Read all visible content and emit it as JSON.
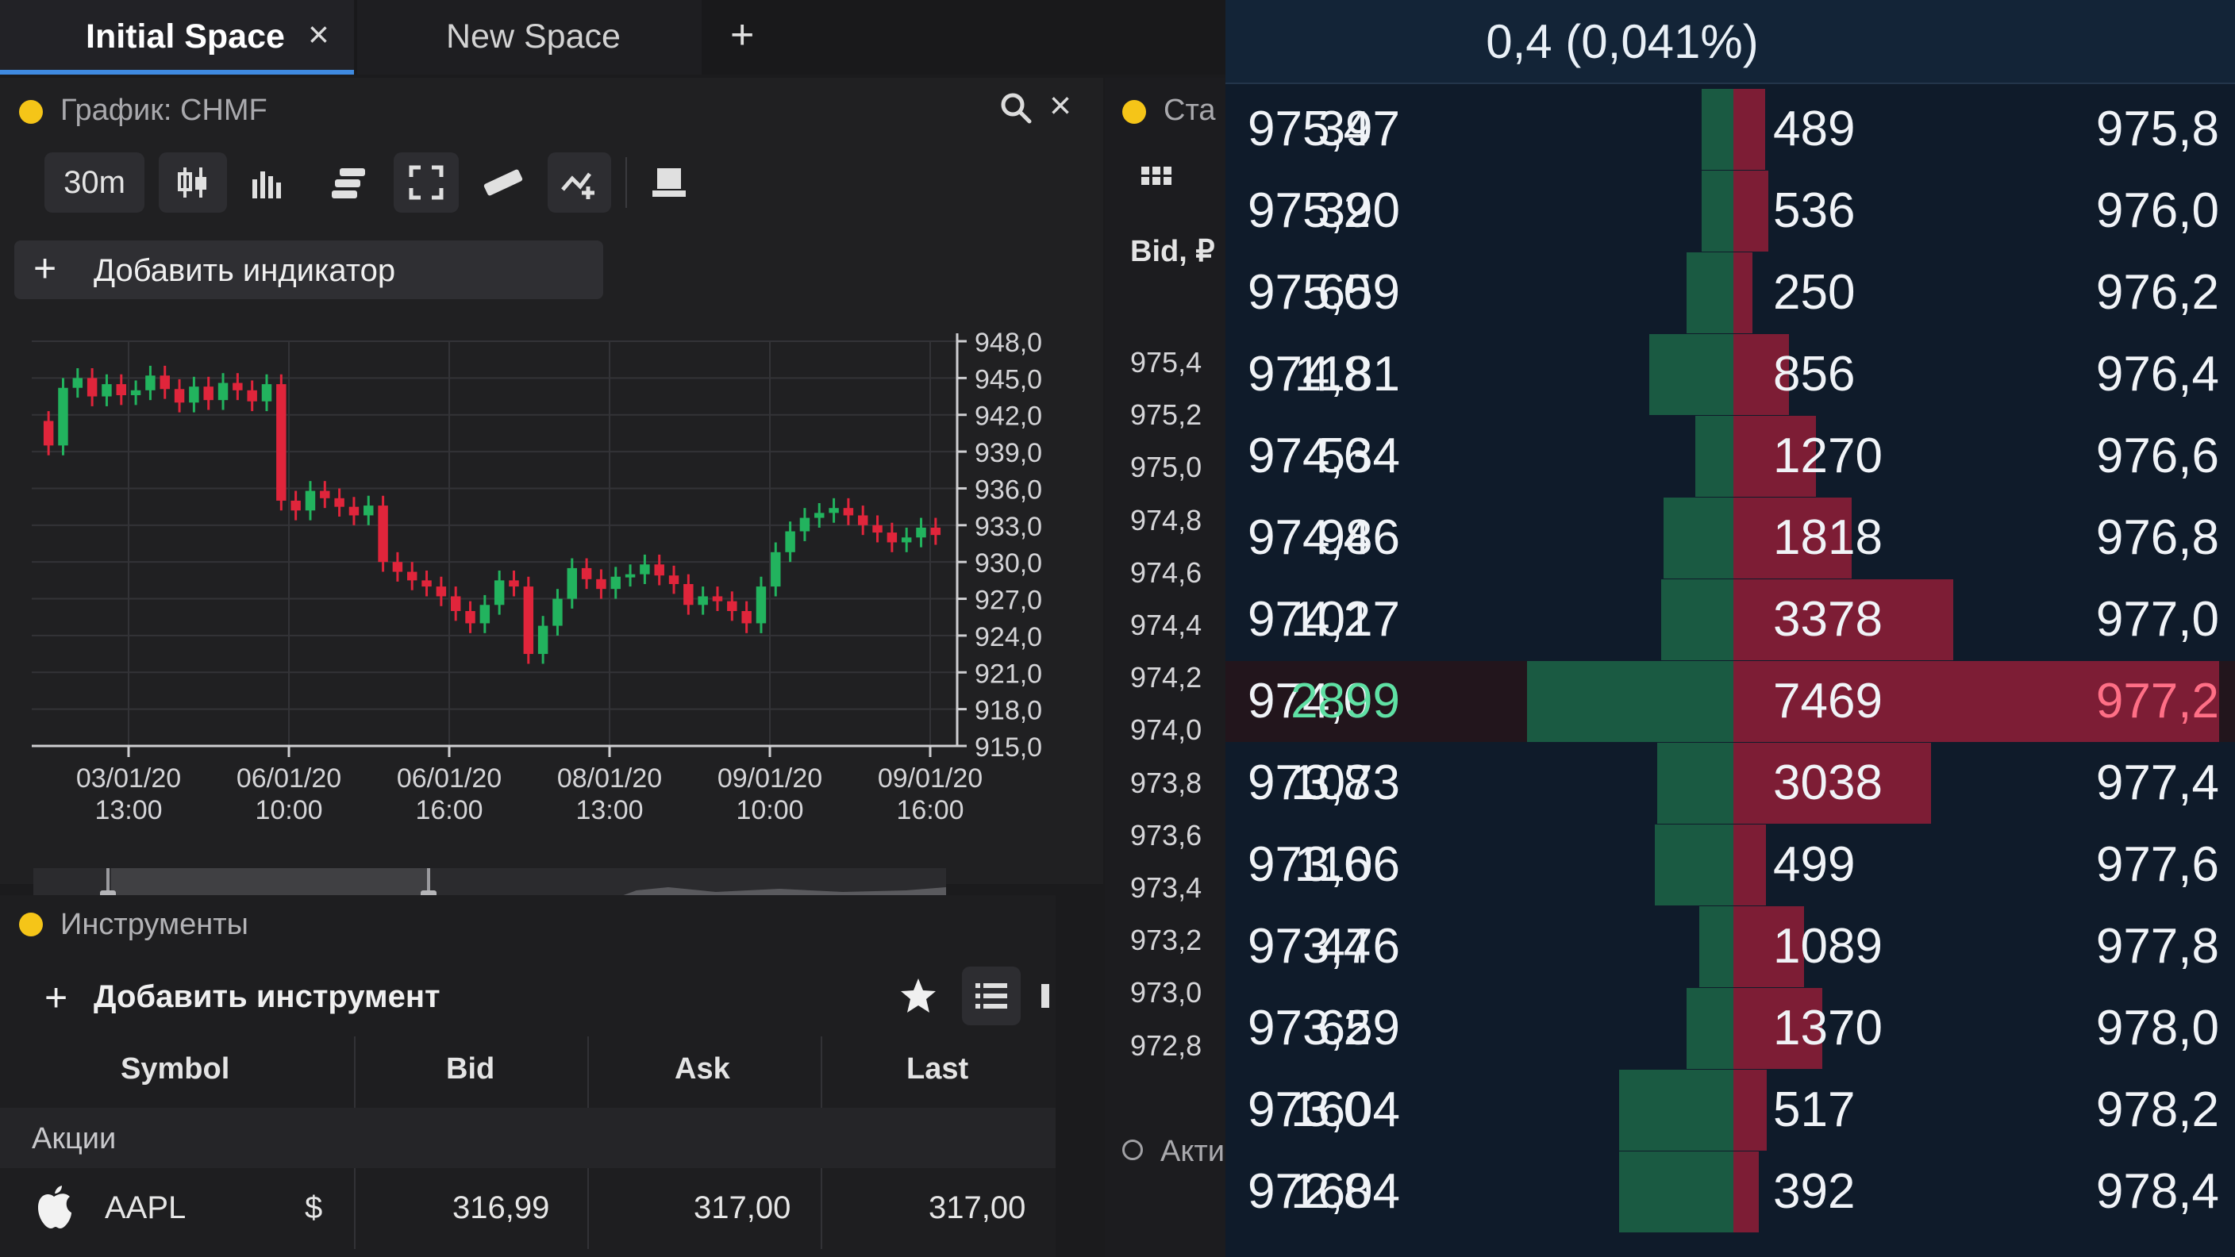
{
  "tabs": [
    {
      "label": "Initial Space",
      "active": true,
      "close": "×"
    },
    {
      "label": "New Space",
      "active": false
    }
  ],
  "tab_add": "+",
  "chart_panel": {
    "title": "График: CHMF",
    "search_icon": "search-icon",
    "close": "×",
    "timeframe": "30m",
    "toolbar_icons": [
      "candles-icon",
      "bars-icon",
      "layers-icon",
      "fullscreen-icon",
      "ruler-icon",
      "compare-icon",
      "save-icon"
    ],
    "add_indicator": "Добавить индикатор",
    "plus": "+"
  },
  "chart_data": {
    "type": "candlestick",
    "title": "",
    "ylim": [
      915.0,
      948.0
    ],
    "y_ticks": [
      "948,0",
      "945,0",
      "942,0",
      "939,0",
      "936,0",
      "933,0",
      "930,0",
      "927,0",
      "924,0",
      "921,0",
      "918,0",
      "915,0"
    ],
    "x_ticks": [
      {
        "date": "03/01/20",
        "time": "13:00"
      },
      {
        "date": "06/01/20",
        "time": "10:00"
      },
      {
        "date": "06/01/20",
        "time": "16:00"
      },
      {
        "date": "08/01/20",
        "time": "13:00"
      },
      {
        "date": "09/01/20",
        "time": "10:00"
      },
      {
        "date": "09/01/20",
        "time": "16:00"
      }
    ],
    "close_series": [
      939.5,
      944.2,
      945.0,
      943.5,
      944.5,
      943.6,
      944.0,
      945.2,
      944.1,
      943.0,
      944.3,
      943.2,
      944.6,
      944.0,
      943.1,
      944.5,
      935.0,
      934.2,
      935.8,
      935.2,
      934.5,
      933.8,
      934.6,
      930.0,
      929.2,
      928.5,
      928.0,
      927.2,
      926.0,
      925.0,
      926.5,
      928.5,
      928.0,
      922.5,
      924.8,
      927.0,
      929.5,
      928.6,
      927.8,
      928.8,
      929.0,
      929.8,
      928.9,
      928.2,
      926.5,
      927.2,
      926.8,
      926.0,
      925.0,
      928.0,
      930.8,
      932.5,
      933.6,
      934.0,
      934.4,
      933.8,
      933.0,
      932.4,
      931.6,
      932.0,
      932.8,
      932.2
    ]
  },
  "instruments": {
    "title": "Инструменты",
    "add_label": "Добавить инструмент",
    "plus": "+",
    "star_icon": "star-icon",
    "list_icon": "list-icon",
    "columns": [
      "Symbol",
      "Bid",
      "Ask",
      "Last"
    ],
    "section": "Акции",
    "rows": [
      {
        "logo": "apple-icon",
        "symbol": "AAPL",
        "currency": "$",
        "bid": "316,99",
        "ask": "317,00",
        "last": "317,00"
      }
    ]
  },
  "middle": {
    "title_fragment": "Ста",
    "header_fragment": "Bid, ₽",
    "footer_fragment": "Акти",
    "prices": [
      "975,4",
      "975,2",
      "975,0",
      "974,8",
      "974,6",
      "974,4",
      "974,2",
      "974,0",
      "973,8",
      "973,6",
      "973,4",
      "973,2",
      "973,0",
      "972,8"
    ]
  },
  "order_book": {
    "change": "0,4 (0,041%)",
    "rows": [
      {
        "bid": "975,4",
        "bid_vol": "397",
        "bid_vol_n": 397,
        "ask_vol": "489",
        "ask_vol_n": 489,
        "ask": "975,8"
      },
      {
        "bid": "975,2",
        "bid_vol": "390",
        "bid_vol_n": 390,
        "ask_vol": "536",
        "ask_vol_n": 536,
        "ask": "976,0"
      },
      {
        "bid": "975,0",
        "bid_vol": "659",
        "bid_vol_n": 659,
        "ask_vol": "250",
        "ask_vol_n": 250,
        "ask": "976,2"
      },
      {
        "bid": "974,8",
        "bid_vol": "1181",
        "bid_vol_n": 1181,
        "ask_vol": "856",
        "ask_vol_n": 856,
        "ask": "976,4"
      },
      {
        "bid": "974,6",
        "bid_vol": "534",
        "bid_vol_n": 534,
        "ask_vol": "1270",
        "ask_vol_n": 1270,
        "ask": "976,6"
      },
      {
        "bid": "974,4",
        "bid_vol": "986",
        "bid_vol_n": 986,
        "ask_vol": "1818",
        "ask_vol_n": 1818,
        "ask": "976,8"
      },
      {
        "bid": "974,2",
        "bid_vol": "1017",
        "bid_vol_n": 1017,
        "ask_vol": "3378",
        "ask_vol_n": 3378,
        "ask": "977,0"
      },
      {
        "bid": "974,0",
        "bid_vol": "2899",
        "bid_vol_n": 2899,
        "ask_vol": "7469",
        "ask_vol_n": 7469,
        "ask": "977,2",
        "highlight": true
      },
      {
        "bid": "973,8",
        "bid_vol": "1073",
        "bid_vol_n": 1073,
        "ask_vol": "3038",
        "ask_vol_n": 3038,
        "ask": "977,4"
      },
      {
        "bid": "973,6",
        "bid_vol": "1106",
        "bid_vol_n": 1106,
        "ask_vol": "499",
        "ask_vol_n": 499,
        "ask": "977,6"
      },
      {
        "bid": "973,4",
        "bid_vol": "476",
        "bid_vol_n": 476,
        "ask_vol": "1089",
        "ask_vol_n": 1089,
        "ask": "977,8"
      },
      {
        "bid": "973,2",
        "bid_vol": "659",
        "bid_vol_n": 659,
        "ask_vol": "1370",
        "ask_vol_n": 1370,
        "ask": "978,0"
      },
      {
        "bid": "973,0",
        "bid_vol": "1604",
        "bid_vol_n": 1604,
        "ask_vol": "517",
        "ask_vol_n": 517,
        "ask": "978,2"
      },
      {
        "bid": "972,8",
        "bid_vol": "1604",
        "bid_vol_n": 1604,
        "ask_vol": "392",
        "ask_vol_n": 392,
        "ask": "978,4"
      }
    ]
  },
  "colors": {
    "accent": "#3f8ae0",
    "dot": "#f5c518",
    "candle_up": "#22b35e",
    "candle_down": "#e0253b",
    "bid_bar": "#1a5a42",
    "ask_bar": "#7d1d35"
  }
}
